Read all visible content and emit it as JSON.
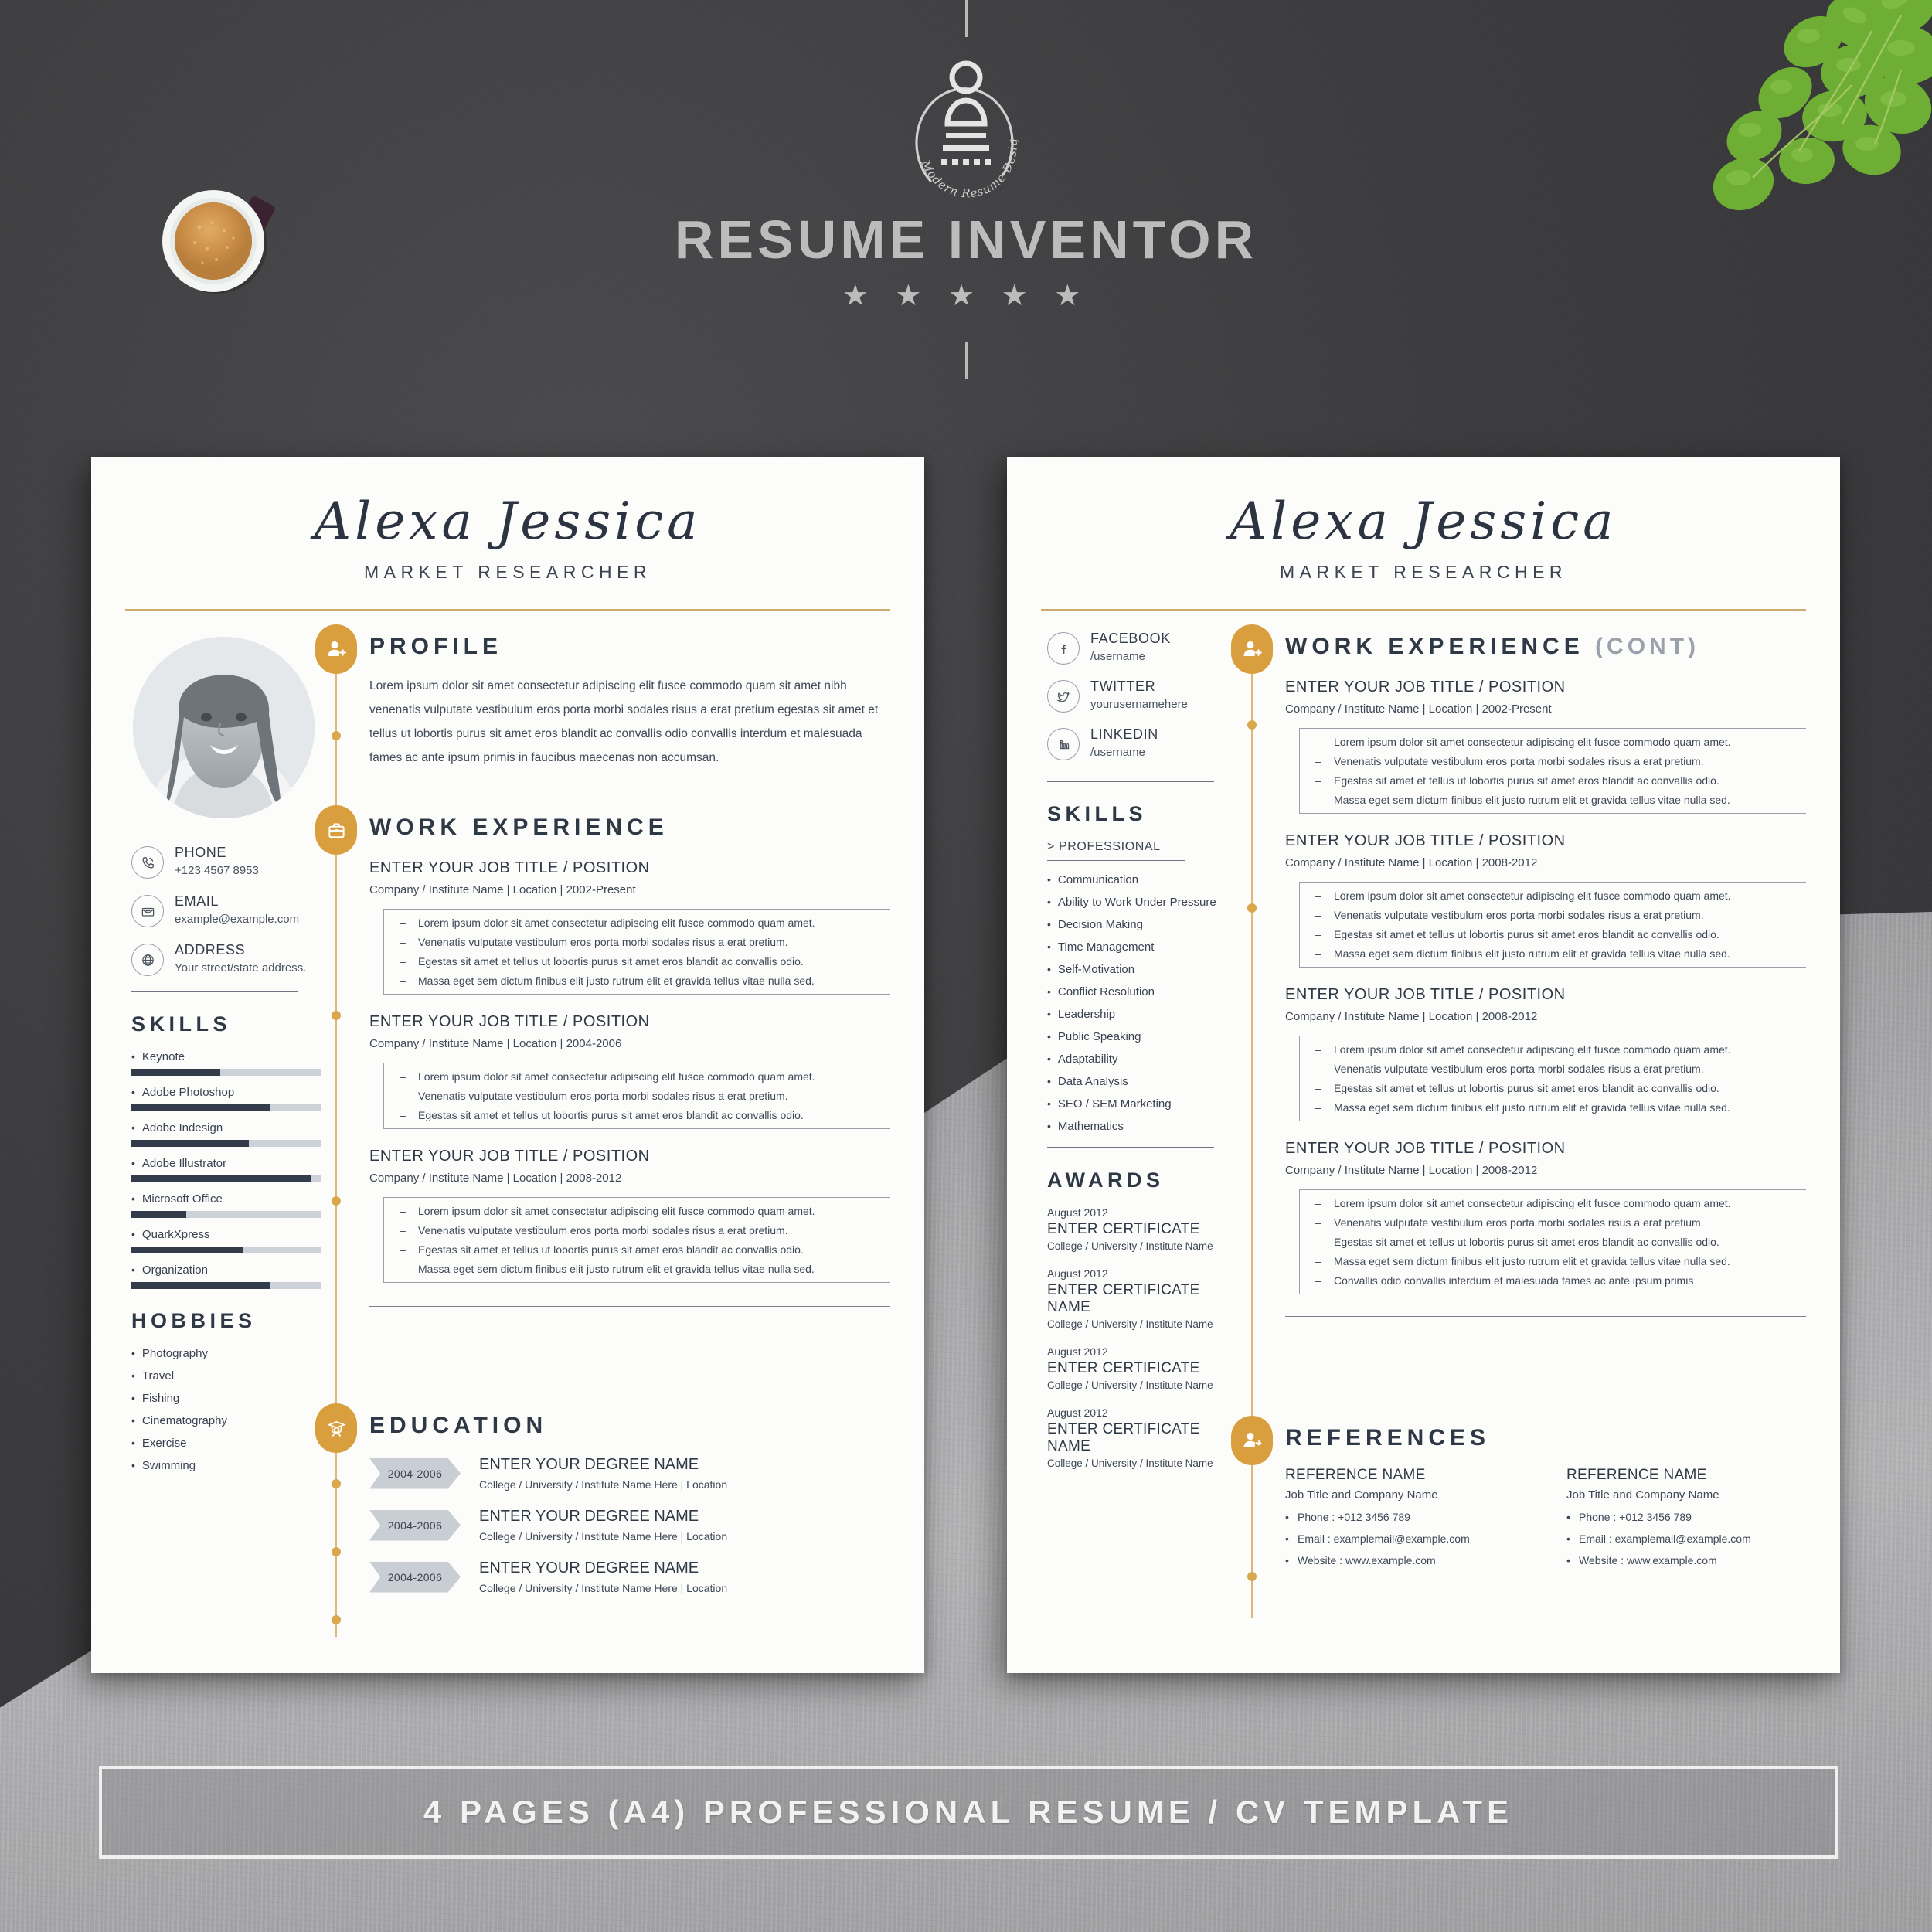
{
  "brand": {
    "title": "RESUME INVENTOR",
    "tagline": "Modern Resume Design",
    "stars": "★ ★ ★ ★ ★",
    "emblem_icon": "resume-person-emblem-icon"
  },
  "decor": {
    "coffee_icon": "coffee-cup",
    "plant_icon": "pothos-plant"
  },
  "colors": {
    "accent_gold": "#d99f3f",
    "rule_gold": "#cbab6e",
    "ink": "#2f3845",
    "bar_fill": "#333c4a",
    "bar_track": "#ccd2d8",
    "page_bg": "#fcfcfa",
    "backdrop": "#3e3e40"
  },
  "page_left": {
    "name": "Alexa Jessica",
    "role": "MARKET RESEARCHER",
    "photo_alt": "profile-photo",
    "contact": [
      {
        "icon": "phone-icon",
        "label": "PHONE",
        "value": "+123 4567 8953"
      },
      {
        "icon": "email-icon",
        "label": "EMAIL",
        "value": "example@example.com"
      },
      {
        "icon": "globe-icon",
        "label": "ADDRESS",
        "value": "Your street/state address."
      }
    ],
    "skills_heading": "SKILLS",
    "skills": [
      {
        "name": "Keynote",
        "level": 47
      },
      {
        "name": "Adobe Photoshop",
        "level": 73
      },
      {
        "name": "Adobe Indesign",
        "level": 62
      },
      {
        "name": "Adobe Illustrator",
        "level": 95
      },
      {
        "name": "Microsoft Office",
        "level": 29
      },
      {
        "name": "QuarkXpress",
        "level": 59
      },
      {
        "name": "Organization",
        "level": 73
      }
    ],
    "hobbies_heading": "HOBBIES",
    "hobbies": [
      "Photography",
      "Travel",
      "Fishing",
      "Cinematography",
      "Exercise",
      "Swimming"
    ],
    "profile": {
      "icon": "user-add-icon",
      "title": "PROFILE",
      "text": "Lorem ipsum dolor sit amet consectetur adipiscing elit fusce commodo quam sit amet nibh venenatis vulputate vestibulum eros porta morbi sodales risus a erat pretium egestas sit amet et tellus ut lobortis purus sit amet eros blandit ac convallis odio convallis interdum et malesuada fames ac ante ipsum primis in faucibus maecenas non accumsan."
    },
    "work": {
      "icon": "briefcase-icon",
      "title": "WORK EXPERIENCE",
      "jobs": [
        {
          "title": "ENTER YOUR JOB TITLE / POSITION",
          "meta": "Company / Institute Name  |  Location  |  2002-Present",
          "bullets": [
            "Lorem ipsum dolor sit amet consectetur adipiscing elit fusce commodo quam amet.",
            "Venenatis vulputate vestibulum eros porta morbi sodales risus a erat pretium.",
            "Egestas sit amet et tellus ut lobortis purus sit amet eros blandit ac convallis odio.",
            "Massa eget sem dictum finibus  elit justo rutrum elit et gravida tellus vitae nulla sed."
          ]
        },
        {
          "title": "ENTER YOUR JOB TITLE / POSITION",
          "meta": "Company / Institute Name  |  Location  |  2004-2006",
          "bullets": [
            "Lorem ipsum dolor sit amet consectetur adipiscing elit fusce commodo quam amet.",
            "Venenatis vulputate vestibulum eros porta morbi sodales risus a erat pretium.",
            "Egestas sit amet et tellus ut lobortis purus sit amet eros blandit ac convallis odio."
          ]
        },
        {
          "title": "ENTER YOUR JOB TITLE / POSITION",
          "meta": "Company / Institute Name  |  Location  |  2008-2012",
          "bullets": [
            "Lorem ipsum dolor sit amet consectetur adipiscing elit fusce commodo quam amet.",
            "Venenatis vulputate vestibulum eros porta morbi sodales risus a erat pretium.",
            "Egestas sit amet et tellus ut lobortis purus sit amet eros blandit ac convallis odio.",
            "Massa eget sem dictum finibus  elit justo rutrum elit et gravida tellus vitae nulla sed."
          ]
        }
      ]
    },
    "education": {
      "icon": "graduation-icon",
      "title": "EDUCATION",
      "entries": [
        {
          "years": "2004-2006",
          "degree": "ENTER YOUR DEGREE NAME",
          "sub": "College / University / Institute Name Here   |   Location"
        },
        {
          "years": "2004-2006",
          "degree": "ENTER YOUR DEGREE NAME",
          "sub": "College / University / Institute Name Here   |   Location"
        },
        {
          "years": "2004-2006",
          "degree": "ENTER YOUR DEGREE NAME",
          "sub": "College / University / Institute Name Here   |   Location"
        }
      ]
    }
  },
  "page_right": {
    "name": "Alexa Jessica",
    "role": "MARKET RESEARCHER",
    "social": [
      {
        "icon": "facebook-icon",
        "label": "FACEBOOK",
        "value": "/username"
      },
      {
        "icon": "twitter-icon",
        "label": "TWITTER",
        "value": "yourusernamehere"
      },
      {
        "icon": "linkedin-icon",
        "label": "LINKEDIN",
        "value": "/username"
      }
    ],
    "skills_heading": "SKILLS",
    "skills_subheading": "> PROFESSIONAL",
    "skills": [
      "Communication",
      "Ability to Work Under Pressure",
      "Decision Making",
      "Time Management",
      "Self-Motivation",
      "Conflict Resolution",
      "Leadership",
      "Public Speaking",
      "Adaptability",
      "Data Analysis",
      "SEO / SEM Marketing",
      "Mathematics"
    ],
    "awards_heading": "AWARDS",
    "awards": [
      {
        "date": "August 2012",
        "name": "ENTER CERTIFICATE",
        "sub": "College / University / Institute Name"
      },
      {
        "date": "August 2012",
        "name": "ENTER CERTIFICATE NAME",
        "sub": "College / University / Institute Name"
      },
      {
        "date": "August 2012",
        "name": "ENTER CERTIFICATE",
        "sub": "College / University / Institute Name"
      },
      {
        "date": "August 2012",
        "name": "ENTER CERTIFICATE NAME",
        "sub": "College / University / Institute Name"
      }
    ],
    "work": {
      "icon": "user-add-icon",
      "title": "WORK EXPERIENCE",
      "title_cont": "(CONT)",
      "jobs": [
        {
          "title": "ENTER YOUR JOB TITLE / POSITION",
          "meta": "Company / Institute Name  |  Location  |  2002-Present",
          "bullets": [
            "Lorem ipsum dolor sit amet consectetur adipiscing elit fusce commodo quam amet.",
            "Venenatis vulputate vestibulum eros porta morbi sodales risus a erat pretium.",
            "Egestas sit amet et tellus ut lobortis purus sit amet eros blandit ac convallis odio.",
            "Massa eget sem dictum finibus  elit justo rutrum elit et gravida tellus vitae nulla sed."
          ]
        },
        {
          "title": "ENTER YOUR JOB TITLE / POSITION",
          "meta": "Company / Institute Name  |  Location  |  2008-2012",
          "bullets": [
            "Lorem ipsum dolor sit amet consectetur adipiscing elit fusce commodo quam amet.",
            "Venenatis vulputate vestibulum eros porta morbi sodales risus a erat pretium.",
            "Egestas sit amet et tellus ut lobortis purus sit amet eros blandit ac convallis odio.",
            "Massa eget sem dictum finibus  elit justo rutrum elit et gravida tellus vitae nulla sed."
          ]
        },
        {
          "title": "ENTER YOUR JOB TITLE / POSITION",
          "meta": "Company / Institute Name  |  Location  |  2008-2012",
          "bullets": [
            "Lorem ipsum dolor sit amet consectetur adipiscing elit fusce commodo quam amet.",
            "Venenatis vulputate vestibulum eros porta morbi sodales risus a erat pretium.",
            "Egestas sit amet et tellus ut lobortis purus sit amet eros blandit ac convallis odio.",
            "Massa eget sem dictum finibus  elit justo rutrum elit et gravida tellus vitae nulla sed."
          ]
        },
        {
          "title": "ENTER YOUR JOB TITLE / POSITION",
          "meta": "Company / Institute Name  |  Location  |  2008-2012",
          "bullets": [
            "Lorem ipsum dolor sit amet consectetur adipiscing elit fusce commodo quam amet.",
            "Venenatis vulputate vestibulum eros porta morbi sodales risus a erat pretium.",
            "Egestas sit amet et tellus ut lobortis purus sit amet eros blandit ac convallis odio.",
            "Massa eget sem dictum finibus  elit justo rutrum elit et gravida tellus vitae nulla sed.",
            "Convallis odio convallis interdum et malesuada fames ac ante ipsum primis"
          ]
        }
      ]
    },
    "references": {
      "icon": "user-share-icon",
      "title": "REFERENCES",
      "items": [
        {
          "name": "REFERENCE NAME",
          "job": "Job Title and Company Name",
          "lines": [
            "Phone : +012 3456 789",
            "Email : examplemail@example.com",
            "Website : www.example.com"
          ]
        },
        {
          "name": "REFERENCE NAME",
          "job": "Job Title and Company Name",
          "lines": [
            "Phone : +012 3456 789",
            "Email : examplemail@example.com",
            "Website : www.example.com"
          ]
        }
      ]
    }
  },
  "banner": {
    "text": "4 PAGES (A4) PROFESSIONAL RESUME / CV TEMPLATE"
  }
}
